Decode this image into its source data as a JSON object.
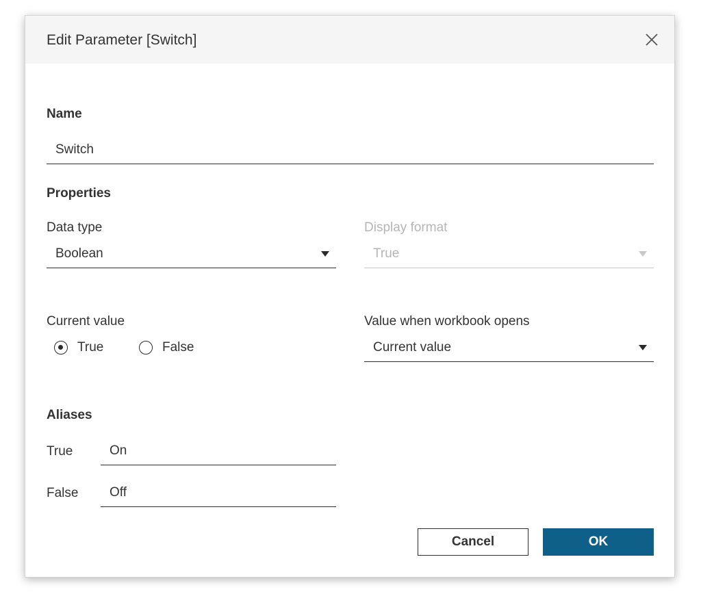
{
  "dialog": {
    "title": "Edit Parameter [Switch]"
  },
  "name_section": {
    "heading": "Name",
    "value": "Switch"
  },
  "properties": {
    "heading": "Properties",
    "data_type_label": "Data type",
    "data_type_value": "Boolean",
    "display_format_label": "Display format",
    "display_format_value": "True",
    "current_value_label": "Current value",
    "current_value_options": [
      "True",
      "False"
    ],
    "current_value_selected": "True",
    "workbook_opens_label": "Value when workbook opens",
    "workbook_opens_value": "Current value"
  },
  "aliases": {
    "heading": "Aliases",
    "true_label": "True",
    "true_value": "On",
    "false_label": "False",
    "false_value": "Off"
  },
  "buttons": {
    "cancel": "Cancel",
    "ok": "OK"
  },
  "colors": {
    "primary": "#0f6089",
    "text": "#333333",
    "disabled": "#b5b5b5",
    "titlebar": "#f5f5f5"
  },
  "icons": {
    "close": "close-icon",
    "dropdown": "caret-down-icon"
  }
}
